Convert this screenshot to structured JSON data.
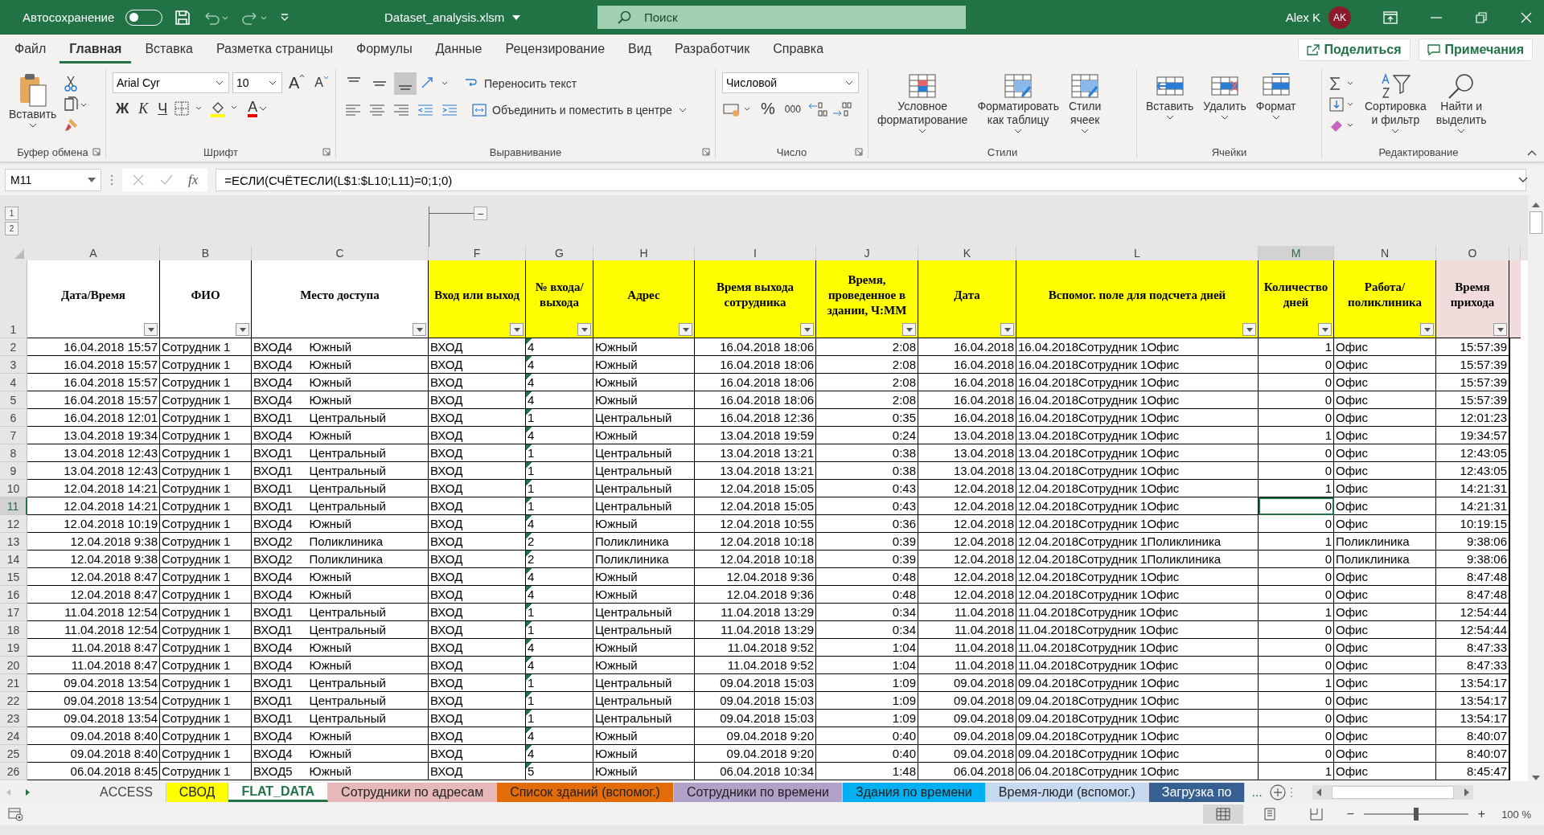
{
  "title_bar": {
    "autosave_label": "Автосохранение",
    "autosave_on": false,
    "filename": "Dataset_analysis.xlsm",
    "search_placeholder": "Поиск",
    "user": "Alex K",
    "avatar": "AK"
  },
  "menu_tabs": [
    {
      "label": "Файл",
      "selected": false
    },
    {
      "label": "Главная",
      "selected": true
    },
    {
      "label": "Вставка",
      "selected": false
    },
    {
      "label": "Разметка страницы",
      "selected": false
    },
    {
      "label": "Формулы",
      "selected": false
    },
    {
      "label": "Данные",
      "selected": false
    },
    {
      "label": "Рецензирование",
      "selected": false
    },
    {
      "label": "Вид",
      "selected": false
    },
    {
      "label": "Разработчик",
      "selected": false
    },
    {
      "label": "Справка",
      "selected": false
    }
  ],
  "share_button": "Поделиться",
  "comments_button": "Примечания",
  "ribbon": {
    "clipboard": {
      "label": "Буфер обмена",
      "paste": "Вставить"
    },
    "font": {
      "label": "Шрифт",
      "family": "Arial Cyr",
      "size": "10",
      "grow": "A",
      "shrink": "A",
      "bold": "Ж",
      "italic": "К",
      "underline": "Ч",
      "color_letter": "A"
    },
    "alignment": {
      "label": "Выравнивание",
      "wrap": "Переносить текст",
      "merge": "Объединить и поместить в центре",
      "bottom_align_selected": true
    },
    "number": {
      "label": "Число",
      "format": "Числовой",
      "percent": "%",
      "thousands": "000"
    },
    "styles": {
      "label": "Стили",
      "buttons": [
        {
          "lines": [
            "Условное",
            "форматирование"
          ]
        },
        {
          "lines": [
            "Форматировать",
            "как таблицу"
          ]
        },
        {
          "lines": [
            "Стили",
            "ячеек"
          ]
        }
      ]
    },
    "cells": {
      "label": "Ячейки",
      "buttons": [
        "Вставить",
        "Удалить",
        "Формат"
      ]
    },
    "editing": {
      "label": "Редактирование",
      "buttons": [
        {
          "lines": [
            "Сортировка",
            "и фильтр"
          ]
        },
        {
          "lines": [
            "Найти и",
            "выделить"
          ]
        }
      ]
    }
  },
  "formula_bar": {
    "name_box": "M11",
    "fx": "fx",
    "formula": "=ЕСЛИ(СЧЁТЕСЛИ(L$1:$L10;L11)=0;1;0)"
  },
  "outline": {
    "levels": [
      "1",
      "2"
    ],
    "collapse": "−"
  },
  "columns": [
    {
      "letter": "A",
      "title": "Дата/Время",
      "color": "#ffffff",
      "selected": false
    },
    {
      "letter": "B",
      "title": "ФИО",
      "color": "#ffffff",
      "selected": false
    },
    {
      "letter": "C",
      "title": "Место доступа",
      "color": "#ffffff",
      "selected": false
    },
    {
      "letter": "F",
      "title": "Вход или выход",
      "color": "#ffff00",
      "selected": false
    },
    {
      "letter": "G",
      "title": "№ входа/выхода",
      "color": "#ffff00",
      "selected": false,
      "error_marker": true
    },
    {
      "letter": "H",
      "title": "Адрес",
      "color": "#ffff00",
      "selected": false
    },
    {
      "letter": "I",
      "title": "Время выхода сотрудника",
      "color": "#ffff00",
      "selected": false
    },
    {
      "letter": "J",
      "title": "Время, проведенное в здании, Ч:ММ",
      "color": "#ffff00",
      "selected": false
    },
    {
      "letter": "K",
      "title": "Дата",
      "color": "#ffff00",
      "selected": false
    },
    {
      "letter": "L",
      "title": "Вспомог. поле для подсчета дней",
      "color": "#ffff00",
      "selected": false
    },
    {
      "letter": "M",
      "title": "Количество дней",
      "color": "#ffff00",
      "selected": true
    },
    {
      "letter": "N",
      "title": "Работа/поликлиника",
      "color": "#ffff00",
      "selected": false
    },
    {
      "letter": "O",
      "title": "Время прихода",
      "color": "#f2dcdb",
      "selected": false
    }
  ],
  "header_row_number": "1",
  "rows": [
    {
      "num": "2",
      "selected": false,
      "cells": [
        "16.04.2018 15:57",
        "Сотрудник 1",
        "ВХОД4     Южный",
        "ВХОД",
        "4",
        "Южный",
        "16.04.2018 18:06",
        "2:08",
        "16.04.2018",
        "16.04.2018Сотрудник 1Офис",
        "1",
        "Офис",
        "15:57:39"
      ]
    },
    {
      "num": "3",
      "selected": false,
      "cells": [
        "16.04.2018 15:57",
        "Сотрудник 1",
        "ВХОД4     Южный",
        "ВХОД",
        "4",
        "Южный",
        "16.04.2018 18:06",
        "2:08",
        "16.04.2018",
        "16.04.2018Сотрудник 1Офис",
        "0",
        "Офис",
        "15:57:39"
      ]
    },
    {
      "num": "4",
      "selected": false,
      "cells": [
        "16.04.2018 15:57",
        "Сотрудник 1",
        "ВХОД4     Южный",
        "ВХОД",
        "4",
        "Южный",
        "16.04.2018 18:06",
        "2:08",
        "16.04.2018",
        "16.04.2018Сотрудник 1Офис",
        "0",
        "Офис",
        "15:57:39"
      ]
    },
    {
      "num": "5",
      "selected": false,
      "cells": [
        "16.04.2018 15:57",
        "Сотрудник 1",
        "ВХОД4     Южный",
        "ВХОД",
        "4",
        "Южный",
        "16.04.2018 18:06",
        "2:08",
        "16.04.2018",
        "16.04.2018Сотрудник 1Офис",
        "0",
        "Офис",
        "15:57:39"
      ]
    },
    {
      "num": "6",
      "selected": false,
      "cells": [
        "16.04.2018 12:01",
        "Сотрудник 1",
        "ВХОД1     Центральный",
        "ВХОД",
        "1",
        "Центральный",
        "16.04.2018 12:36",
        "0:35",
        "16.04.2018",
        "16.04.2018Сотрудник 1Офис",
        "0",
        "Офис",
        "12:01:23"
      ]
    },
    {
      "num": "7",
      "selected": false,
      "cells": [
        "13.04.2018 19:34",
        "Сотрудник 1",
        "ВХОД4     Южный",
        "ВХОД",
        "4",
        "Южный",
        "13.04.2018 19:59",
        "0:24",
        "13.04.2018",
        "13.04.2018Сотрудник 1Офис",
        "1",
        "Офис",
        "19:34:57"
      ]
    },
    {
      "num": "8",
      "selected": false,
      "cells": [
        "13.04.2018 12:43",
        "Сотрудник 1",
        "ВХОД1     Центральный",
        "ВХОД",
        "1",
        "Центральный",
        "13.04.2018 13:21",
        "0:38",
        "13.04.2018",
        "13.04.2018Сотрудник 1Офис",
        "0",
        "Офис",
        "12:43:05"
      ]
    },
    {
      "num": "9",
      "selected": false,
      "cells": [
        "13.04.2018 12:43",
        "Сотрудник 1",
        "ВХОД1     Центральный",
        "ВХОД",
        "1",
        "Центральный",
        "13.04.2018 13:21",
        "0:38",
        "13.04.2018",
        "13.04.2018Сотрудник 1Офис",
        "0",
        "Офис",
        "12:43:05"
      ]
    },
    {
      "num": "10",
      "selected": false,
      "cells": [
        "12.04.2018 14:21",
        "Сотрудник 1",
        "ВХОД1     Центральный",
        "ВХОД",
        "1",
        "Центральный",
        "12.04.2018 15:05",
        "0:43",
        "12.04.2018",
        "12.04.2018Сотрудник 1Офис",
        "1",
        "Офис",
        "14:21:31"
      ]
    },
    {
      "num": "11",
      "selected": true,
      "cells": [
        "12.04.2018 14:21",
        "Сотрудник 1",
        "ВХОД1     Центральный",
        "ВХОД",
        "1",
        "Центральный",
        "12.04.2018 15:05",
        "0:43",
        "12.04.2018",
        "12.04.2018Сотрудник 1Офис",
        "0",
        "Офис",
        "14:21:31"
      ]
    },
    {
      "num": "12",
      "selected": false,
      "cells": [
        "12.04.2018 10:19",
        "Сотрудник 1",
        "ВХОД4     Южный",
        "ВХОД",
        "4",
        "Южный",
        "12.04.2018 10:55",
        "0:36",
        "12.04.2018",
        "12.04.2018Сотрудник 1Офис",
        "0",
        "Офис",
        "10:19:15"
      ]
    },
    {
      "num": "13",
      "selected": false,
      "cells": [
        "12.04.2018 9:38",
        "Сотрудник 1",
        "ВХОД2     Поликлиника",
        "ВХОД",
        "2",
        "Поликлиника",
        "12.04.2018 10:18",
        "0:39",
        "12.04.2018",
        "12.04.2018Сотрудник 1Поликлиника",
        "1",
        "Поликлиника",
        "9:38:06"
      ]
    },
    {
      "num": "14",
      "selected": false,
      "cells": [
        "12.04.2018 9:38",
        "Сотрудник 1",
        "ВХОД2     Поликлиника",
        "ВХОД",
        "2",
        "Поликлиника",
        "12.04.2018 10:18",
        "0:39",
        "12.04.2018",
        "12.04.2018Сотрудник 1Поликлиника",
        "0",
        "Поликлиника",
        "9:38:06"
      ]
    },
    {
      "num": "15",
      "selected": false,
      "cells": [
        "12.04.2018 8:47",
        "Сотрудник 1",
        "ВХОД4     Южный",
        "ВХОД",
        "4",
        "Южный",
        "12.04.2018 9:36",
        "0:48",
        "12.04.2018",
        "12.04.2018Сотрудник 1Офис",
        "0",
        "Офис",
        "8:47:48"
      ]
    },
    {
      "num": "16",
      "selected": false,
      "cells": [
        "12.04.2018 8:47",
        "Сотрудник 1",
        "ВХОД4     Южный",
        "ВХОД",
        "4",
        "Южный",
        "12.04.2018 9:36",
        "0:48",
        "12.04.2018",
        "12.04.2018Сотрудник 1Офис",
        "0",
        "Офис",
        "8:47:48"
      ]
    },
    {
      "num": "17",
      "selected": false,
      "cells": [
        "11.04.2018 12:54",
        "Сотрудник 1",
        "ВХОД1     Центральный",
        "ВХОД",
        "1",
        "Центральный",
        "11.04.2018 13:29",
        "0:34",
        "11.04.2018",
        "11.04.2018Сотрудник 1Офис",
        "1",
        "Офис",
        "12:54:44"
      ]
    },
    {
      "num": "18",
      "selected": false,
      "cells": [
        "11.04.2018 12:54",
        "Сотрудник 1",
        "ВХОД1     Центральный",
        "ВХОД",
        "1",
        "Центральный",
        "11.04.2018 13:29",
        "0:34",
        "11.04.2018",
        "11.04.2018Сотрудник 1Офис",
        "0",
        "Офис",
        "12:54:44"
      ]
    },
    {
      "num": "19",
      "selected": false,
      "cells": [
        "11.04.2018 8:47",
        "Сотрудник 1",
        "ВХОД4     Южный",
        "ВХОД",
        "4",
        "Южный",
        "11.04.2018 9:52",
        "1:04",
        "11.04.2018",
        "11.04.2018Сотрудник 1Офис",
        "0",
        "Офис",
        "8:47:33"
      ]
    },
    {
      "num": "20",
      "selected": false,
      "cells": [
        "11.04.2018 8:47",
        "Сотрудник 1",
        "ВХОД4     Южный",
        "ВХОД",
        "4",
        "Южный",
        "11.04.2018 9:52",
        "1:04",
        "11.04.2018",
        "11.04.2018Сотрудник 1Офис",
        "0",
        "Офис",
        "8:47:33"
      ]
    },
    {
      "num": "21",
      "selected": false,
      "cells": [
        "09.04.2018 13:54",
        "Сотрудник 1",
        "ВХОД1     Центральный",
        "ВХОД",
        "1",
        "Центральный",
        "09.04.2018 15:03",
        "1:09",
        "09.04.2018",
        "09.04.2018Сотрудник 1Офис",
        "1",
        "Офис",
        "13:54:17"
      ]
    },
    {
      "num": "22",
      "selected": false,
      "cells": [
        "09.04.2018 13:54",
        "Сотрудник 1",
        "ВХОД1     Центральный",
        "ВХОД",
        "1",
        "Центральный",
        "09.04.2018 15:03",
        "1:09",
        "09.04.2018",
        "09.04.2018Сотрудник 1Офис",
        "0",
        "Офис",
        "13:54:17"
      ]
    },
    {
      "num": "23",
      "selected": false,
      "cells": [
        "09.04.2018 13:54",
        "Сотрудник 1",
        "ВХОД1     Центральный",
        "ВХОД",
        "1",
        "Центральный",
        "09.04.2018 15:03",
        "1:09",
        "09.04.2018",
        "09.04.2018Сотрудник 1Офис",
        "0",
        "Офис",
        "13:54:17"
      ]
    },
    {
      "num": "24",
      "selected": false,
      "cells": [
        "09.04.2018 8:40",
        "Сотрудник 1",
        "ВХОД4     Южный",
        "ВХОД",
        "4",
        "Южный",
        "09.04.2018 9:20",
        "0:40",
        "09.04.2018",
        "09.04.2018Сотрудник 1Офис",
        "0",
        "Офис",
        "8:40:07"
      ]
    },
    {
      "num": "25",
      "selected": false,
      "cells": [
        "09.04.2018 8:40",
        "Сотрудник 1",
        "ВХОД4     Южный",
        "ВХОД",
        "4",
        "Южный",
        "09.04.2018 9:20",
        "0:40",
        "09.04.2018",
        "09.04.2018Сотрудник 1Офис",
        "0",
        "Офис",
        "8:40:07"
      ]
    },
    {
      "num": "26",
      "selected": false,
      "cells": [
        "06.04.2018 8:45",
        "Сотрудник 1",
        "ВХОД5     Южный",
        "ВХОД",
        "5",
        "Южный",
        "06.04.2018 10:34",
        "1:48",
        "06.04.2018",
        "06.04.2018Сотрудник 1Офис",
        "1",
        "Офис",
        "8:45:47"
      ]
    }
  ],
  "sheet_tabs": [
    {
      "label": "ACCESS",
      "selected": false
    },
    {
      "label": "СВОД",
      "selected": false,
      "color": "#ffff00"
    },
    {
      "label": "FLAT_DATA",
      "selected": true,
      "color": "#217346"
    },
    {
      "label": "Сотрудники по адресам",
      "selected": false,
      "color": "#e6b8b7"
    },
    {
      "label": "Список зданий (вспомог.)",
      "selected": false,
      "color": "#e26b0a"
    },
    {
      "label": "Сотрудники по времени",
      "selected": false,
      "color": "#b1a0c7"
    },
    {
      "label": "Здания по времени",
      "selected": false,
      "color": "#00b0f0"
    },
    {
      "label": "Время-люди (вспомог.)",
      "selected": false,
      "color": "#c5d9f1"
    },
    {
      "label": "Загрузка по",
      "selected": false,
      "color": "#366092"
    }
  ],
  "more_tabs": "...",
  "status_bar": {
    "views": [
      {
        "kind": "normal",
        "selected": true
      },
      {
        "kind": "layout",
        "selected": false
      },
      {
        "kind": "pagebreak",
        "selected": false
      }
    ],
    "zoom_minus": "−",
    "zoom_plus": "+",
    "zoom": {
      "level": 0.5
    },
    "zoom_text": "100 %"
  }
}
